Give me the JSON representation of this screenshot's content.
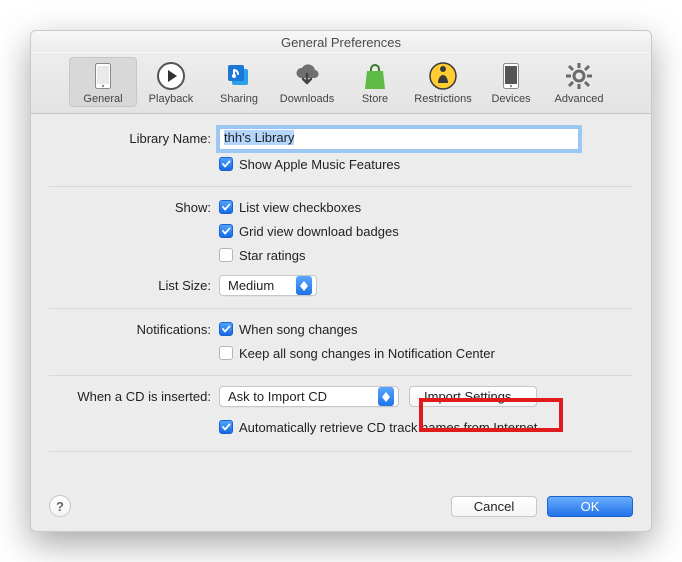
{
  "title": "General Preferences",
  "toolbar": [
    {
      "label": "General"
    },
    {
      "label": "Playback"
    },
    {
      "label": "Sharing"
    },
    {
      "label": "Downloads"
    },
    {
      "label": "Store"
    },
    {
      "label": "Restrictions"
    },
    {
      "label": "Devices"
    },
    {
      "label": "Advanced"
    }
  ],
  "library": {
    "label": "Library Name:",
    "value": "thh's Library",
    "show_apple_music": "Show Apple Music Features"
  },
  "show": {
    "label": "Show:",
    "list_view_checkboxes": "List view checkboxes",
    "grid_badges": "Grid view download badges",
    "star_ratings": "Star ratings"
  },
  "listsize": {
    "label": "List Size:",
    "value": "Medium"
  },
  "notifications": {
    "label": "Notifications:",
    "when_song_changes": "When song changes",
    "keep_all": "Keep all song changes in Notification Center"
  },
  "cd": {
    "label": "When a CD is inserted:",
    "action_value": "Ask to Import CD",
    "import_settings": "Import Settings...",
    "auto_retrieve": "Automatically retrieve CD track names from Internet"
  },
  "footer": {
    "cancel": "Cancel",
    "ok": "OK"
  }
}
